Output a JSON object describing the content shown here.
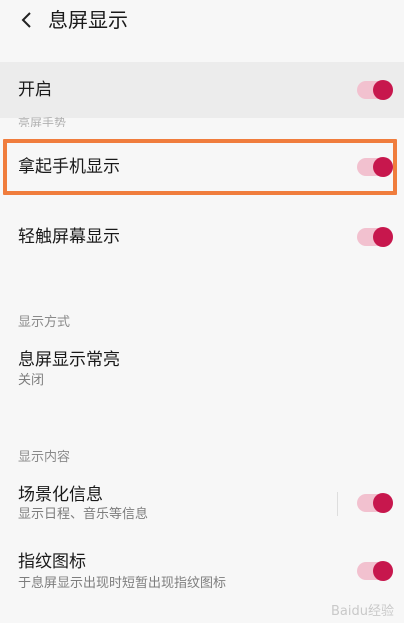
{
  "header": {
    "title": "息屏显示",
    "back_icon": "chevron-left-icon"
  },
  "master": {
    "label": "开启",
    "enabled": true
  },
  "hidden_section_label": "亮屏手势",
  "rows": {
    "pickup": {
      "label": "拿起手机显示",
      "enabled": true
    },
    "tap": {
      "label": "轻触屏幕显示",
      "enabled": true
    }
  },
  "sections": {
    "mode": {
      "label": "显示方式",
      "always_on": {
        "label": "息屏显示常亮",
        "value": "关闭"
      }
    },
    "content": {
      "label": "显示内容",
      "scene": {
        "label": "场景化信息",
        "sub": "显示日程、音乐等信息",
        "enabled": true
      },
      "fingerprint": {
        "label": "指纹图标",
        "sub": "于息屏显示出现时短暂出现指纹图标",
        "enabled": true
      }
    }
  },
  "watermark": "Baidu经验",
  "colors": {
    "accent": "#c7174d",
    "track": "#f2c1cf",
    "highlight": "#f07d3d"
  }
}
